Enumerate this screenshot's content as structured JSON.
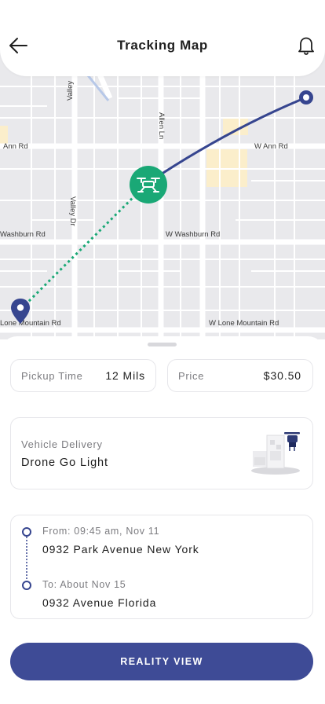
{
  "header": {
    "title": "Tracking Map",
    "back_icon": "arrow-left-icon",
    "notification_icon": "bell-icon"
  },
  "map": {
    "streets": {
      "valley_north": "Valley",
      "allen": "Allen Ln",
      "ann_west": "Ann Rd",
      "ann_east": "W Ann Rd",
      "valley_dr": "Valley Dr",
      "washburn_west": "Washburn Rd",
      "washburn_east": "W Washburn Rd",
      "lone_mountain_west": "Lone Mountain Rd",
      "lone_mountain_east": "W Lone Mountain Rd"
    },
    "drone_icon": "drone-icon",
    "origin_icon": "location-pin-icon",
    "route_color": "#36458f",
    "traveled_color": "#1aa876"
  },
  "summary": {
    "pickup_label": "Pickup Time",
    "pickup_value": "12 Mils",
    "price_label": "Price",
    "price_value": "$30.50"
  },
  "vehicle": {
    "label": "Vehicle Delivery",
    "name": "Drone Go Light"
  },
  "route": {
    "from_label": "From: 09:45 am, Nov 11",
    "from_address": "0932 Park Avenue New York",
    "to_label": "To: About Nov 15",
    "to_address": "0932 Avenue Florida"
  },
  "cta": {
    "label": "REALITY VIEW"
  },
  "colors": {
    "accent": "#3e4b96",
    "drone_green": "#1aa876"
  }
}
